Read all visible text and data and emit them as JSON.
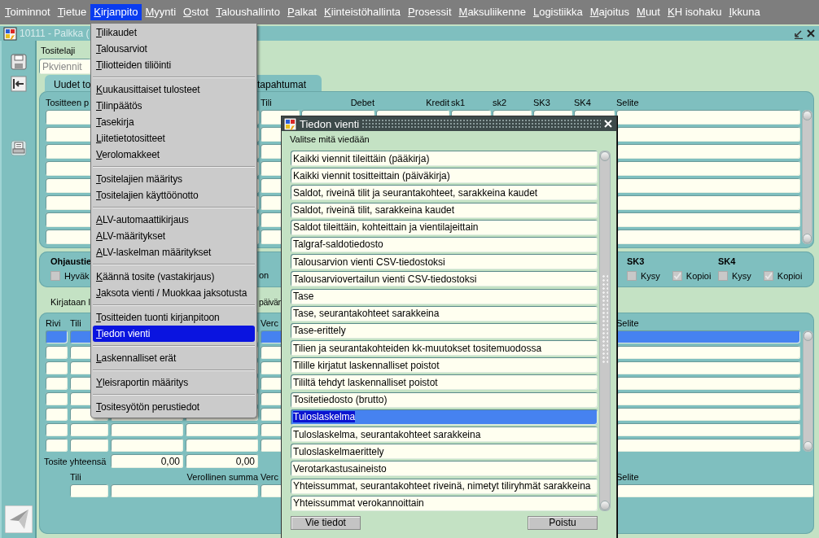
{
  "menubar": {
    "items": [
      {
        "label": "Toiminnot",
        "selected": false
      },
      {
        "label": "Tietue",
        "selected": false
      },
      {
        "label": "Kirjanpito",
        "selected": true
      },
      {
        "label": "Myynti",
        "selected": false
      },
      {
        "label": "Ostot",
        "selected": false
      },
      {
        "label": "Taloushallinto",
        "selected": false
      },
      {
        "label": "Palkat",
        "selected": false
      },
      {
        "label": "Kiinteistöhallinta",
        "selected": false
      },
      {
        "label": "Prosessit",
        "selected": false
      },
      {
        "label": "Maksuliikenne",
        "selected": false
      },
      {
        "label": "Logistiikka",
        "selected": false
      },
      {
        "label": "Majoitus",
        "selected": false
      },
      {
        "label": "Muut",
        "selected": false
      },
      {
        "label": "KH isohaku",
        "selected": false
      },
      {
        "label": "Ikkuna",
        "selected": false
      }
    ]
  },
  "window": {
    "title": "10111 - Palkka (",
    "tositelaji_label": "Tositelaji",
    "tositelaji_value": "Pkviennit",
    "tabs": [
      {
        "label": "Uudet to",
        "selected": true
      },
      {
        "label": "tapahtumat",
        "selected": false
      }
    ],
    "entries": {
      "columns": [
        "Tositteen p",
        "Tili",
        "Debet",
        "Kredit",
        "sk1",
        "sk2",
        "SK3",
        "SK4",
        "Selite"
      ]
    },
    "control": {
      "title": "Ohjaustie",
      "approve": {
        "label": "Hyväk",
        "checked": false
      },
      "note": "on",
      "groups": [
        {
          "title": "SK3",
          "ask": {
            "label": "Kysy",
            "checked": false
          },
          "copy": {
            "label": "Kopioi",
            "checked": true
          }
        },
        {
          "title": "SK4",
          "ask": {
            "label": "Kysy",
            "checked": false
          },
          "copy": {
            "label": "Kopioi",
            "checked": true
          }
        }
      ]
    },
    "posting": {
      "label": "Kirjataan l",
      "label_2": "päivän"
    },
    "lines": {
      "columns": [
        "Rivi",
        "Tili",
        "Verc",
        "Selite"
      ],
      "rows": [
        {
          "selected": true
        },
        {
          "selected": false
        },
        {
          "selected": false
        },
        {
          "selected": false
        },
        {
          "selected": false
        },
        {
          "selected": false
        },
        {
          "selected": false
        },
        {
          "selected": false
        }
      ]
    },
    "totals": {
      "label": "Tosite yhteensä",
      "values": [
        "0,00",
        "0,00"
      ]
    },
    "detail": {
      "columns": [
        "Tili",
        "Verollinen summa",
        "Verc",
        "Selite"
      ]
    }
  },
  "menu": {
    "groups": [
      [
        {
          "label": "Tilikaudet",
          "selected": false
        },
        {
          "label": "Talousarviot",
          "selected": false
        },
        {
          "label": "Tiliotteiden tiliöinti",
          "selected": false
        }
      ],
      [
        {
          "label": "Kuukausittaiset tulosteet",
          "selected": false
        },
        {
          "label": "Tilinpäätös",
          "selected": false
        },
        {
          "label": "Tasekirja",
          "selected": false
        },
        {
          "label": "Liitetietotositteet",
          "selected": false
        },
        {
          "label": "Verolomakkeet",
          "selected": false
        }
      ],
      [
        {
          "label": "Tositelajien määritys",
          "selected": false
        },
        {
          "label": "Tositelajien käyttöönotto",
          "selected": false
        }
      ],
      [
        {
          "label": "ALV-automaattikirjaus",
          "selected": false
        },
        {
          "label": "ALV-määritykset",
          "selected": false
        },
        {
          "label": "ALV-laskelman määritykset",
          "selected": false
        }
      ],
      [
        {
          "label": "Käännä tosite (vastakirjaus)",
          "selected": false
        },
        {
          "label": "Jaksota vienti / Muokkaa jaksotusta",
          "selected": false
        }
      ],
      [
        {
          "label": "Tositteiden tuonti kirjanpitoon",
          "selected": false
        },
        {
          "label": "Tiedon vienti",
          "selected": true
        }
      ],
      [
        {
          "label": "Laskennalliset erät",
          "selected": false
        }
      ],
      [
        {
          "label": "Yleisraportin määritys",
          "selected": false
        }
      ],
      [
        {
          "label": "Tositesyötön perustiedot",
          "selected": false
        }
      ]
    ]
  },
  "dialog": {
    "title": "Tiedon vienti",
    "prompt": "Valitse mitä viedään",
    "options": [
      {
        "label": "Kaikki viennit tileittäin (pääkirja)",
        "selected": false
      },
      {
        "label": "Kaikki viennit tositteittain (päiväkirja)",
        "selected": false
      },
      {
        "label": "Saldot, riveinä tilit ja seurantakohteet, sarakkeina kaudet",
        "selected": false
      },
      {
        "label": "Saldot, riveinä tilit, sarakkeina kaudet",
        "selected": false
      },
      {
        "label": "Saldot tileittäin, kohteittain ja vientilajeittain",
        "selected": false
      },
      {
        "label": "Talgraf-saldotiedosto",
        "selected": false
      },
      {
        "label": "Talousarvion vienti CSV-tiedostoksi",
        "selected": false
      },
      {
        "label": "Talousarviovertailun vienti CSV-tiedostoksi",
        "selected": false
      },
      {
        "label": "Tase",
        "selected": false
      },
      {
        "label": "Tase, seurantakohteet sarakkeina",
        "selected": false
      },
      {
        "label": "Tase-erittely",
        "selected": false
      },
      {
        "label": "Tilien ja seurantakohteiden kk-muutokset tositemuodossa",
        "selected": false
      },
      {
        "label": "Tilille kirjatut laskennalliset poistot",
        "selected": false
      },
      {
        "label": "Tililtä tehdyt laskennalliset poistot",
        "selected": false
      },
      {
        "label": "Tositetiedosto (brutto)",
        "selected": false
      },
      {
        "label": "Tuloslaskelma",
        "selected": true
      },
      {
        "label": "Tuloslaskelma, seurantakohteet sarakkeina",
        "selected": false
      },
      {
        "label": "Tuloslaskelmaerittely",
        "selected": false
      },
      {
        "label": "Verotarkastusaineisto",
        "selected": false
      },
      {
        "label": "Yhteissummat, seurantakohteet riveinä, nimetyt tiliryhmät sarakkeina",
        "selected": false
      },
      {
        "label": "Yhteissummat verokannoittain",
        "selected": false
      }
    ],
    "buttons": [
      "Vie tiedot",
      "Poistu"
    ]
  }
}
